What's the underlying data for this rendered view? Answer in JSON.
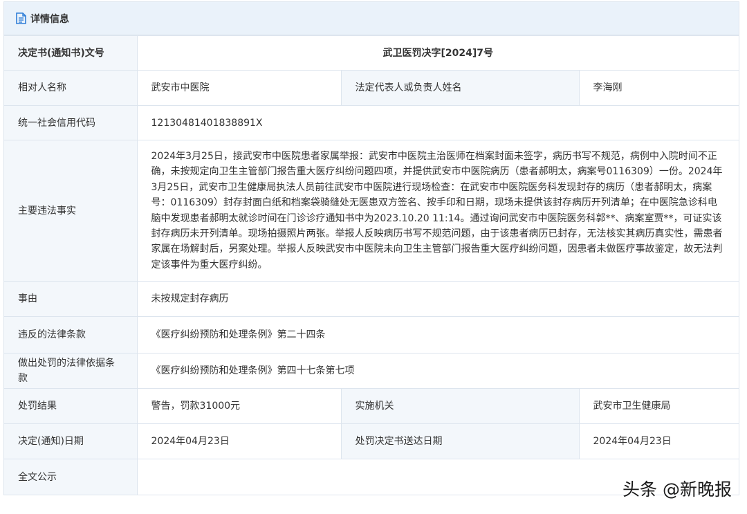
{
  "header": {
    "title": "详情信息",
    "icon": "document-icon"
  },
  "rows": {
    "decision_no": {
      "label": "决定书(通知书)文号",
      "value": "武卫医罚决字[2024]7号"
    },
    "party": {
      "label": "相对人名称",
      "value": "武安市中医院",
      "rep_label": "法定代表人或负责人姓名",
      "rep_value": "李海刚"
    },
    "credit_code": {
      "label": "统一社会信用代码",
      "value": "12130481401838891X"
    },
    "facts": {
      "label": "主要违法事实",
      "value": "2024年3月25日，接武安市中医院患者家属举报：武安市中医院主治医师在档案封面未签字，病历书写不规范，病例中入院时间不正确，未按规定向卫生主管部门报告重大医疗纠纷问题四项，并提供武安市中医院病历（患者郝明太，病案号0116309）一份。2024年3月25日，武安市卫生健康局执法人员前往武安市中医院进行现场检查：在武安市中医院医务科发现封存的病历（患者郝明太，病案号：0116309）封存封面白纸和档案袋骑缝处无医患双方签名、按手印和日期，现场未提供该封存病历开列清单；在中医院急诊科电脑中发现患者郝明太就诊时间在门诊诊疗通知书中为2023.10.20 11:14。通过询问武安市中医院医务科郭**、病案室贾**，可证实该封存病历未开列清单。现场拍摄照片两张。举报人反映病历书写不规范问题，由于该患者病历已封存，无法核实其病历真实性，需患者家属在场解封后，另案处理。举报人反映武安市中医院未向卫生主管部门报告重大医疗纠纷问题，因患者未做医疗事故鉴定，故无法判定该事件为重大医疗纠纷。"
    },
    "cause": {
      "label": "事由",
      "value": "未按规定封存病历"
    },
    "violated_law": {
      "label": "违反的法律条款",
      "value": "《医疗纠纷预防和处理条例》第二十四条"
    },
    "penalty_basis": {
      "label": "做出处罚的法律依据条款",
      "value": "《医疗纠纷预防和处理条例》第四十七条第七项"
    },
    "result": {
      "label": "处罚结果",
      "value": "警告，罚款31000元",
      "org_label": "实施机关",
      "org_value": "武安市卫生健康局"
    },
    "dates": {
      "label": "决定(通知)日期",
      "value": "2024年04月23日",
      "delivery_label": "处罚决定书送达日期",
      "delivery_value": "2024年04月23日"
    },
    "full_text": {
      "label": "全文公示",
      "value": ""
    }
  },
  "watermark": "头条 @新晚报",
  "colors": {
    "header_bg": "#eaf2fa",
    "label_bg": "#f3f7fb",
    "border": "#dde5ee"
  }
}
